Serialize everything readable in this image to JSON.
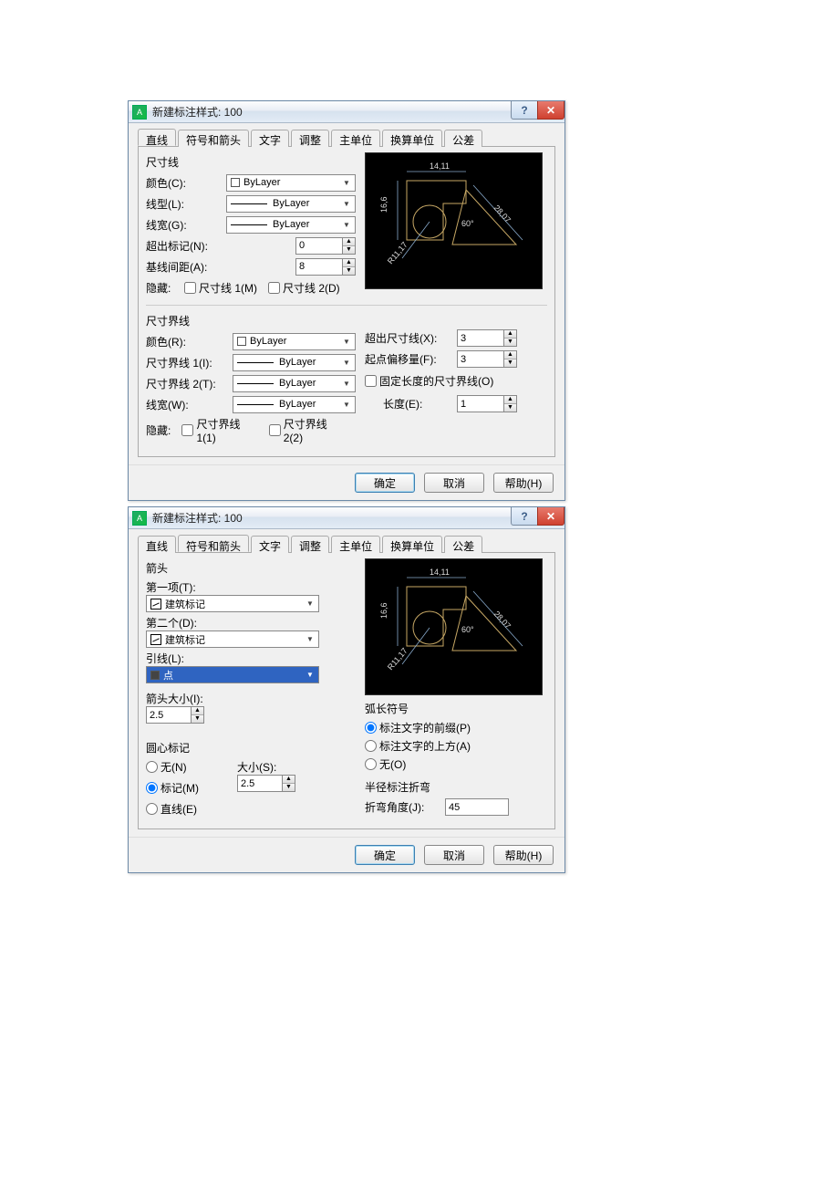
{
  "dialogs": [
    {
      "title": "新建标注样式: 100",
      "tabs": [
        "直线",
        "符号和箭头",
        "文字",
        "调整",
        "主单位",
        "换算单位",
        "公差"
      ],
      "active_tab": 0,
      "lines": {
        "group1_label": "尺寸线",
        "color_label": "颜色(C):",
        "color_value": "ByLayer",
        "linetype_label": "线型(L):",
        "linetype_value": "ByLayer",
        "lineweight_label": "线宽(G):",
        "lineweight_value": "ByLayer",
        "extend_label": "超出标记(N):",
        "extend_value": "0",
        "baseline_label": "基线间距(A):",
        "baseline_value": "8",
        "hide_label": "隐藏:",
        "hide1": "尺寸线 1(M)",
        "hide2": "尺寸线 2(D)"
      },
      "extlines": {
        "group2_label": "尺寸界线",
        "color_label": "颜色(R):",
        "color_value": "ByLayer",
        "ext1_label": "尺寸界线 1(I):",
        "ext1_value": "ByLayer",
        "ext2_label": "尺寸界线 2(T):",
        "ext2_value": "ByLayer",
        "lw_label": "线宽(W):",
        "lw_value": "ByLayer",
        "hide_label": "隐藏:",
        "hide1": "尺寸界线 1(1)",
        "hide2": "尺寸界线 2(2)",
        "beyond_label": "超出尺寸线(X):",
        "beyond_value": "3",
        "offset_label": "起点偏移量(F):",
        "offset_value": "3",
        "fixed_label": "固定长度的尺寸界线(O)",
        "length_label": "长度(E):",
        "length_value": "1"
      },
      "preview": {
        "top_dim": "14,11",
        "left_dim": "16,6",
        "angle": "60°",
        "diag": "28,07",
        "radius": "R11,17"
      },
      "buttons": {
        "ok": "确定",
        "cancel": "取消",
        "help": "帮助(H)"
      }
    },
    {
      "title": "新建标注样式: 100",
      "tabs": [
        "直线",
        "符号和箭头",
        "文字",
        "调整",
        "主单位",
        "换算单位",
        "公差"
      ],
      "active_tab": 1,
      "arrows": {
        "group_label": "箭头",
        "first_label": "第一项(T):",
        "first_value": "建筑标记",
        "second_label": "第二个(D):",
        "second_value": "建筑标记",
        "leader_label": "引线(L):",
        "leader_value": "点",
        "size_label": "箭头大小(I):",
        "size_value": "2.5"
      },
      "center": {
        "group_label": "圆心标记",
        "none_label": "无(N)",
        "mark_label": "标记(M)",
        "line_label": "直线(E)",
        "size_label": "大小(S):",
        "size_value": "2.5",
        "selected": "mark"
      },
      "arc": {
        "group_label": "弧长符号",
        "prefix_label": "标注文字的前缀(P)",
        "above_label": "标注文字的上方(A)",
        "none_label": "无(O)",
        "selected": "prefix"
      },
      "jog": {
        "group_label": "半径标注折弯",
        "angle_label": "折弯角度(J):",
        "angle_value": "45"
      },
      "preview": {
        "top_dim": "14,11",
        "left_dim": "16,6",
        "angle": "60°",
        "diag": "28,07",
        "radius": "R11,17"
      },
      "buttons": {
        "ok": "确定",
        "cancel": "取消",
        "help": "帮助(H)"
      }
    }
  ]
}
